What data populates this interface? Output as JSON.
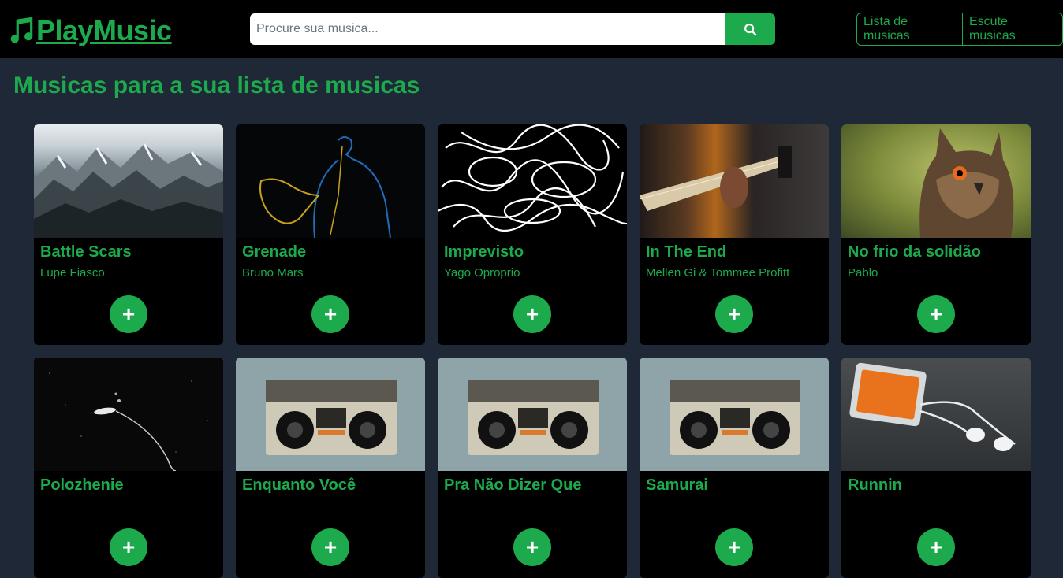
{
  "brand": {
    "name": "PlayMusic",
    "icon": "music-note-icon"
  },
  "search": {
    "placeholder": "Procure sua musica...",
    "value": "",
    "icon": "search-icon"
  },
  "nav": {
    "playlist_label": "Lista de musicas",
    "listen_label": "Escute musicas"
  },
  "section_title": "Musicas para a sua lista de musicas",
  "colors": {
    "accent": "#1daa4c",
    "background": "#1e2837",
    "navbar": "#000000",
    "card": "#000000"
  },
  "cards": [
    {
      "title": "Battle Scars",
      "artist": "Lupe Fiasco",
      "add_label": "+"
    },
    {
      "title": "Grenade",
      "artist": "Bruno Mars",
      "add_label": "+"
    },
    {
      "title": "Imprevisto",
      "artist": "Yago Oproprio",
      "add_label": "+"
    },
    {
      "title": "In The End",
      "artist": "Mellen Gi & Tommee Profitt",
      "add_label": "+"
    },
    {
      "title": "No frio da solidão",
      "artist": "Pablo",
      "add_label": "+"
    },
    {
      "title": "Polozhenie",
      "artist": "",
      "add_label": "+"
    },
    {
      "title": "Enquanto Você",
      "artist": "",
      "add_label": "+"
    },
    {
      "title": "Pra Não Dizer Que",
      "artist": "",
      "add_label": "+"
    },
    {
      "title": "Samurai",
      "artist": "",
      "add_label": "+"
    },
    {
      "title": "Runnin",
      "artist": "",
      "add_label": "+"
    }
  ]
}
